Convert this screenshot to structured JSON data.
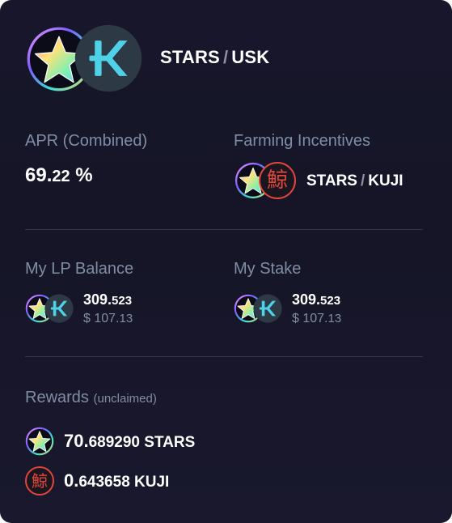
{
  "pair": {
    "base": "STARS",
    "separator": "/",
    "quote": "USK",
    "base_icon": "stars-token-icon",
    "quote_icon": "usk-token-icon"
  },
  "apr": {
    "label": "APR (Combined)",
    "value_int": "69.",
    "value_frac": "22",
    "unit": " %"
  },
  "incentives": {
    "label": "Farming Incentives",
    "token_a": "STARS",
    "separator": "/",
    "token_b": "KUJI"
  },
  "lp_balance": {
    "label": "My LP Balance",
    "amount_int": "309.",
    "amount_frac": "523",
    "usd_prefix": "$ 107.",
    "usd_frac": "13"
  },
  "stake": {
    "label": "My Stake",
    "amount_int": "309.",
    "amount_frac": "523",
    "usd_prefix": "$ 107.",
    "usd_frac": "13"
  },
  "rewards": {
    "label": "Rewards",
    "sublabel": "(unclaimed)",
    "items": [
      {
        "amount_int": "70.",
        "amount_frac": "689290",
        "symbol": " STARS"
      },
      {
        "amount_int": "0.",
        "amount_frac": "643658",
        "symbol": " KUJI"
      }
    ]
  },
  "kuji_glyph": "鯨",
  "colors": {
    "card_bg": "#17162a",
    "label": "#7f8ea3",
    "divider": "#35354a",
    "kuji_red": "#e0463a",
    "usk_teal": "#4fd1e8"
  }
}
